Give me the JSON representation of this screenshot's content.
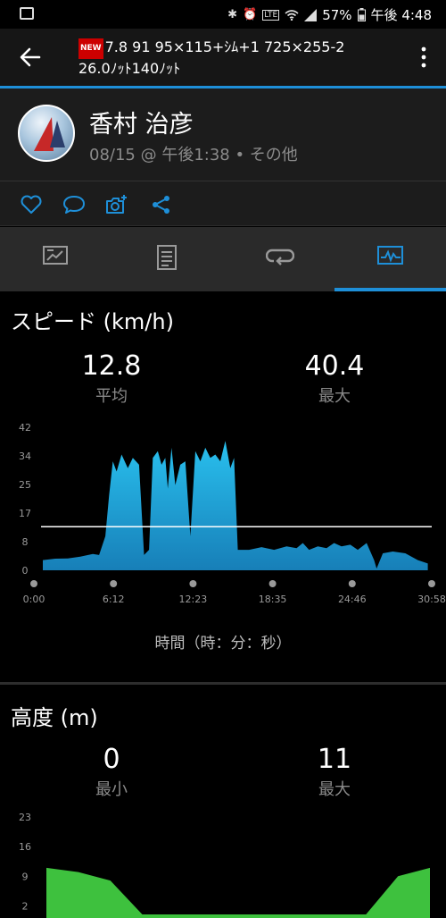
{
  "status_bar": {
    "battery": "57%",
    "time": "午後 4:48",
    "icons": [
      "image-icon",
      "bluetooth-icon",
      "alarm-icon",
      "volte-icon",
      "wifi-icon",
      "signal-icon",
      "battery-icon"
    ]
  },
  "app_bar": {
    "badge": "NEW",
    "title_line1": "7.8 91 95×115+ｼﾑ+1 725×255-2",
    "title_line2": "26.0ﾉｯﾄ140ﾉｯﾄ"
  },
  "profile": {
    "name": "香村 治彦",
    "meta": "08/15 @ 午後1:38 • その他"
  },
  "actions": [
    "like-icon",
    "comment-icon",
    "add-photo-icon",
    "share-icon"
  ],
  "tabs": [
    {
      "name": "summary-tab",
      "icon": "flag-chart-icon"
    },
    {
      "name": "details-tab",
      "icon": "list-icon"
    },
    {
      "name": "laps-tab",
      "icon": "loop-icon"
    },
    {
      "name": "charts-tab",
      "icon": "chart-icon",
      "selected": true
    }
  ],
  "colors": {
    "accent": "#1e8fd8",
    "speed_fill": "#1ea3d9",
    "elevation_fill": "#3ec13e"
  },
  "speed": {
    "title": "スピード (km/h)",
    "avg_value": "12.8",
    "avg_label": "平均",
    "max_value": "40.4",
    "max_label": "最大",
    "xlabel": "時間（時：分：秒）"
  },
  "elevation": {
    "title": "高度 (m)",
    "min_value": "0",
    "min_label": "最小",
    "max_value": "11",
    "max_label": "最大"
  },
  "chart_data": [
    {
      "type": "area",
      "title": "スピード (km/h)",
      "xlabel": "時間（時：分：秒）",
      "ylabel": "",
      "y_ticks": [
        "0",
        "8",
        "17",
        "25",
        "34",
        "42"
      ],
      "ylim": [
        0,
        42
      ],
      "x_ticks": [
        "0:00",
        "6:12",
        "12:23",
        "18:35",
        "24:46",
        "30:58"
      ],
      "xlim_minutes": [
        0,
        30.97
      ],
      "average_line": 12.8,
      "x_minutes": [
        0,
        1,
        2,
        3,
        3.5,
        4,
        4.5,
        5,
        5.3,
        5.6,
        5.9,
        6.3,
        6.8,
        7.2,
        7.7,
        8.1,
        8.5,
        8.8,
        9.2,
        9.5,
        9.8,
        10.0,
        10.3,
        10.6,
        11.0,
        11.4,
        11.8,
        12.2,
        12.6,
        13.0,
        13.4,
        13.8,
        14.2,
        14.6,
        15.0,
        15.3,
        15.6,
        15.9,
        16.5,
        17.5,
        18.5,
        19.5,
        20.3,
        20.8,
        21.3,
        22.0,
        22.7,
        23.3,
        23.9,
        24.6,
        25.2,
        25.9,
        26.5,
        26.7,
        27.2,
        28.0,
        29.0,
        30.0,
        30.8
      ],
      "values": [
        3,
        3.4,
        3.5,
        4,
        4.4,
        4.8,
        4.5,
        10,
        22,
        32,
        29,
        34,
        30,
        33,
        31,
        4.5,
        6,
        33,
        35,
        31,
        33,
        24,
        36,
        25,
        31,
        32,
        10,
        35,
        32,
        36,
        33,
        34,
        32,
        38,
        30,
        33,
        6,
        6,
        6,
        6.8,
        6,
        7,
        6.5,
        8,
        6,
        7,
        6.5,
        8,
        7,
        7.5,
        6,
        8,
        3,
        0.5,
        5,
        5.5,
        5,
        3,
        2
      ]
    },
    {
      "type": "area",
      "title": "高度 (m)",
      "y_ticks": [
        "2",
        "9",
        "16",
        "23"
      ],
      "values_m": [
        11,
        10,
        8,
        0,
        0,
        0,
        0,
        0,
        0,
        0,
        0,
        9,
        11
      ]
    }
  ]
}
